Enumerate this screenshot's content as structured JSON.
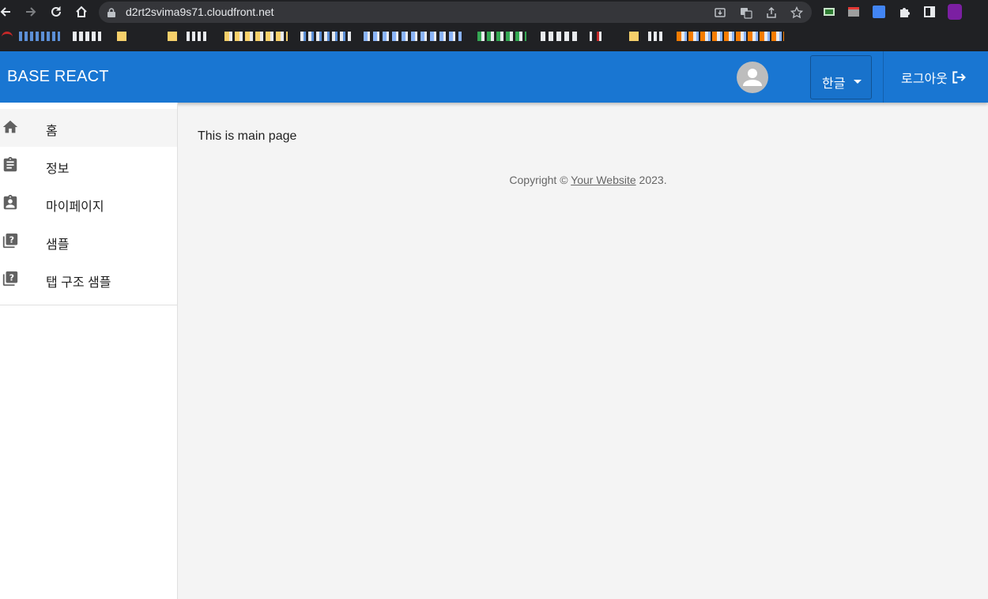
{
  "browser": {
    "url": "d2rt2svima9s71.cloudfront.net"
  },
  "app": {
    "title": "BASE REACT",
    "language_label": "한글",
    "logout_label": "로그아웃"
  },
  "sidebar": {
    "items": [
      {
        "label": "홈",
        "icon": "home-icon"
      },
      {
        "label": "정보",
        "icon": "assignment-icon"
      },
      {
        "label": "마이페이지",
        "icon": "assignment-ind-icon"
      },
      {
        "label": "샘플",
        "icon": "library-question-icon"
      },
      {
        "label": "탭 구조 샘플",
        "icon": "library-question-icon"
      }
    ]
  },
  "main": {
    "message": "This is main page",
    "copyright_prefix": "Copyright © ",
    "copyright_link": "Your Website",
    "copyright_suffix": " 2023."
  },
  "colors": {
    "appbar": "#1976d2",
    "chrome": "#202124",
    "background": "#f4f4f4"
  }
}
